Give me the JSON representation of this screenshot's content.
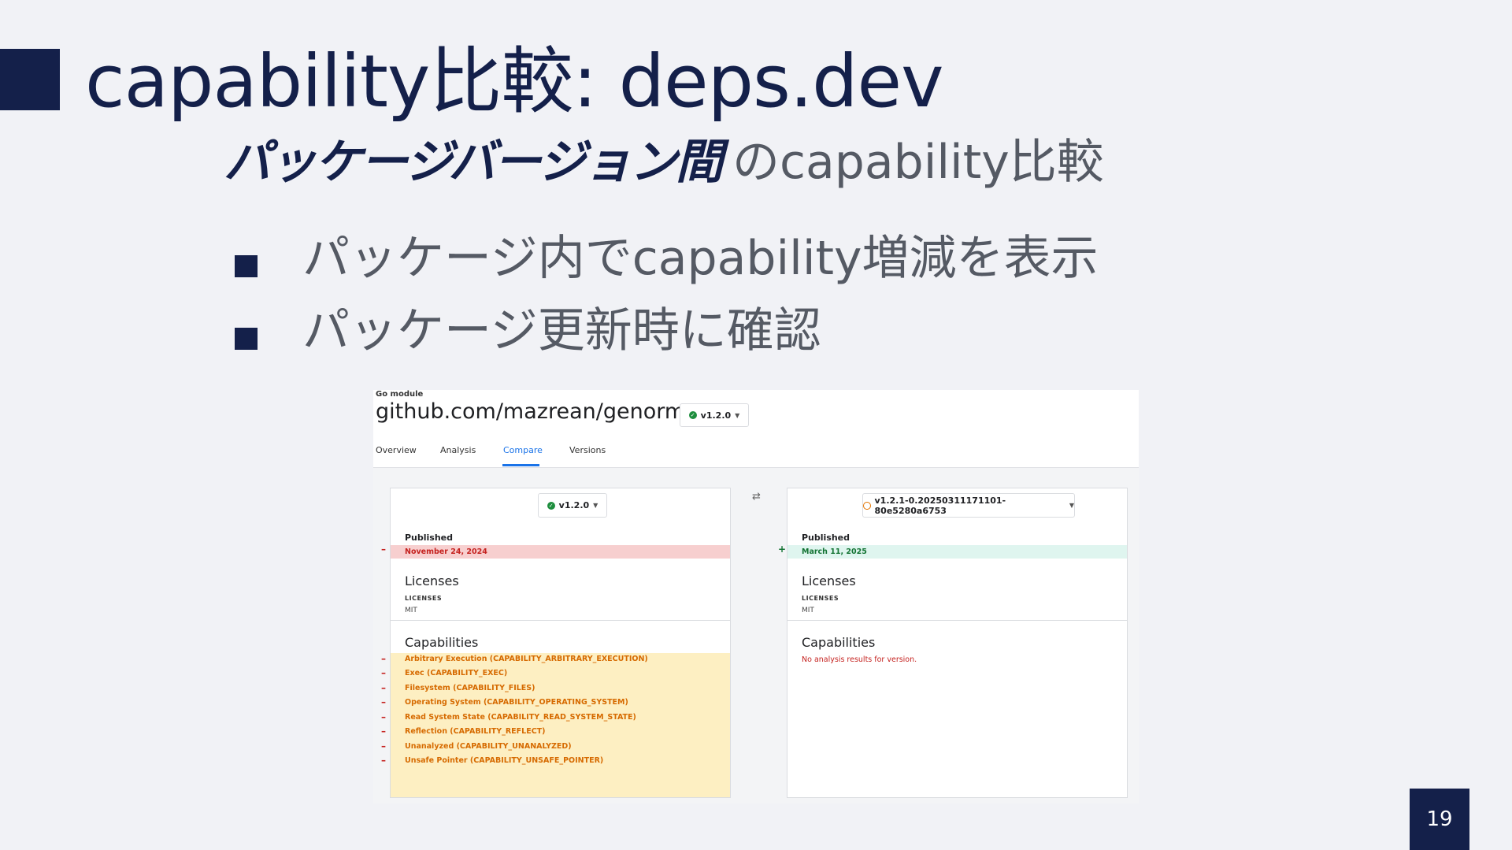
{
  "slide": {
    "title": "capability比較: deps.dev",
    "subtitle_strong": "パッケージバージョン間",
    "subtitle_rest": "のcapability比較",
    "bullets": [
      "パッケージ内でcapability増減を表示",
      "パッケージ更新時に確認"
    ],
    "page_number": "19"
  },
  "screenshot": {
    "kind": "Go module",
    "package": "github.com/mazrean/genorm",
    "version": "v1.2.0",
    "tabs": [
      "Overview",
      "Analysis",
      "Compare",
      "Versions"
    ],
    "active_tab": "Compare",
    "left": {
      "version": "v1.2.0",
      "published_label": "Published",
      "published_date": "November 24, 2024",
      "licenses_title": "Licenses",
      "licenses_label": "LICENSES",
      "license_value": "MIT",
      "capabilities_title": "Capabilities",
      "capabilities": [
        "Arbitrary Execution (CAPABILITY_ARBITRARY_EXECUTION)",
        "Exec (CAPABILITY_EXEC)",
        "Filesystem (CAPABILITY_FILES)",
        "Operating System (CAPABILITY_OPERATING_SYSTEM)",
        "Read System State (CAPABILITY_READ_SYSTEM_STATE)",
        "Reflection (CAPABILITY_REFLECT)",
        "Unanalyzed (CAPABILITY_UNANALYZED)",
        "Unsafe Pointer (CAPABILITY_UNSAFE_POINTER)"
      ]
    },
    "right": {
      "version": "v1.2.1-0.20250311171101-80e5280a6753",
      "published_label": "Published",
      "published_date": "March 11, 2025",
      "licenses_title": "Licenses",
      "licenses_label": "LICENSES",
      "license_value": "MIT",
      "capabilities_title": "Capabilities",
      "no_results": "No analysis results for version."
    },
    "marks": {
      "minus": "–",
      "plus": "+",
      "swap": "⇄"
    },
    "colors": {
      "accent": "#1a73e8",
      "removed_bg": "#f7cfcf",
      "added_bg": "#dff5ef",
      "caps_bg": "#fdefc2",
      "caps_text": "#d66a00"
    }
  }
}
